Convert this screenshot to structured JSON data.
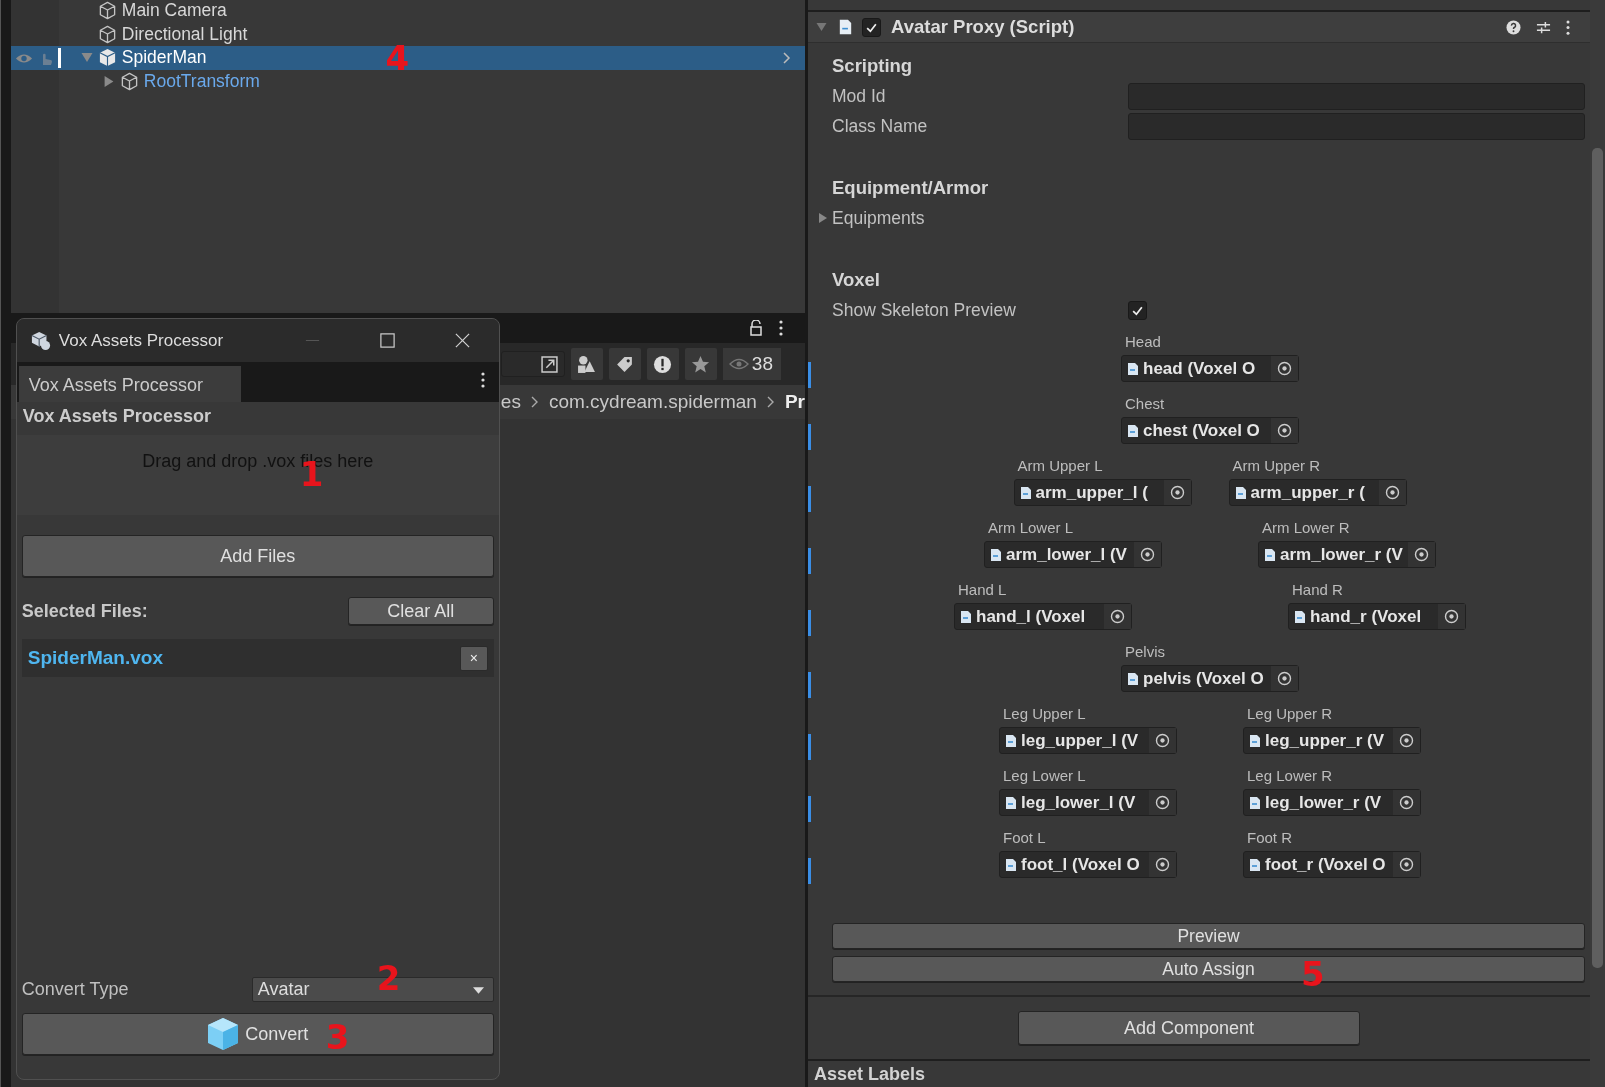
{
  "hierarchy": {
    "items": [
      {
        "name": "Main Camera",
        "kind": "object",
        "selected": false
      },
      {
        "name": "Directional Light",
        "kind": "object",
        "selected": false
      },
      {
        "name": "SpiderMan",
        "kind": "prefab",
        "selected": true,
        "expanded": true,
        "annotation": "4",
        "children": [
          {
            "name": "RootTransform",
            "kind": "prefab-part",
            "selected": false,
            "expanded": false
          }
        ]
      }
    ]
  },
  "project": {
    "item_count": "38",
    "breadcrumb": [
      "es",
      "com.cydream.spiderman",
      "Pr"
    ]
  },
  "vox_window": {
    "title": "Vox Assets Processor",
    "tabs": [
      {
        "label": "Vox Assets Processor",
        "selected": true
      }
    ],
    "heading": "Vox Assets Processor",
    "drop_zone": {
      "text": "Drag and drop .vox files here",
      "annotation": "1"
    },
    "add_button": "Add Files",
    "selected_files_label": "Selected Files:",
    "clear_button": "Clear All",
    "files": [
      {
        "name": "SpiderMan.vox",
        "remove": "×"
      }
    ],
    "convert_type": {
      "label": "Convert Type",
      "value": "Avatar",
      "annotation": "2"
    },
    "convert_button": {
      "label": "Convert",
      "annotation": "3"
    }
  },
  "inspector": {
    "component": {
      "title": "Avatar Proxy (Script)",
      "enabled": true,
      "expanded": true
    },
    "scripting": {
      "heading": "Scripting",
      "fields": [
        {
          "label": "Mod Id"
        },
        {
          "label": "Class Name"
        }
      ]
    },
    "equipment": {
      "heading": "Equipment/Armor",
      "foldout": {
        "label": "Equipments",
        "expanded": false
      }
    },
    "voxel": {
      "heading": "Voxel",
      "toggle": {
        "label": "Show Skeleton Preview",
        "checked": true
      },
      "skeleton": [
        [
          {
            "label": "Head",
            "value": "head (Voxel O"
          }
        ],
        [
          {
            "label": "Chest",
            "value": "chest (Voxel O"
          }
        ],
        [
          {
            "label": "Arm Upper L",
            "value": "arm_upper_l ("
          },
          {
            "label": "Arm Upper R",
            "value": "arm_upper_r ("
          }
        ],
        [
          {
            "label": "Arm Lower L",
            "value": "arm_lower_l (V"
          },
          {
            "label": "Arm Lower R",
            "value": "arm_lower_r (V"
          }
        ],
        [
          {
            "label": "Hand L",
            "value": "hand_l (Voxel"
          },
          {
            "label": "Hand R",
            "value": "hand_r (Voxel"
          }
        ],
        [
          {
            "label": "Pelvis",
            "value": "pelvis (Voxel O"
          }
        ],
        [
          {
            "label": "Leg Upper L",
            "value": "leg_upper_l (V"
          },
          {
            "label": "Leg Upper R",
            "value": "leg_upper_r (V"
          }
        ],
        [
          {
            "label": "Leg Lower L",
            "value": "leg_lower_l (V"
          },
          {
            "label": "Leg Lower R",
            "value": "leg_lower_r (V"
          }
        ],
        [
          {
            "label": "Foot L",
            "value": "foot_l (Voxel O"
          },
          {
            "label": "Foot R",
            "value": "foot_r (Voxel O"
          }
        ]
      ]
    },
    "buttons": [
      {
        "label": "Preview"
      },
      {
        "label": "Auto Assign",
        "annotation": "5"
      }
    ],
    "add_component": "Add Component",
    "asset_labels": "Asset Labels"
  }
}
